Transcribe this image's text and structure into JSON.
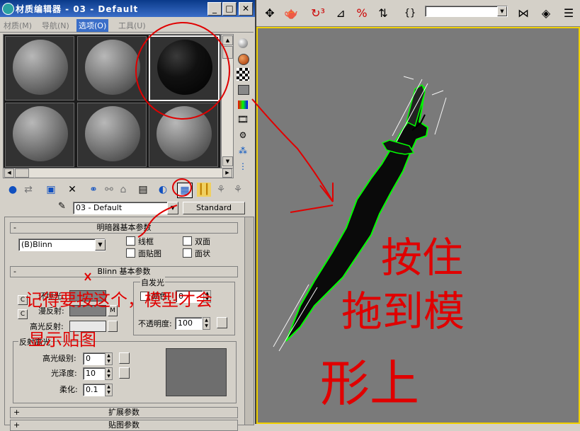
{
  "window": {
    "title": "材质编辑器 - 03 - Default",
    "minimize_icon": "minimize-icon",
    "maximize_icon": "maximize-icon",
    "close_icon": "close-icon"
  },
  "menu": [
    "材质(M)",
    "导航(N)",
    "选项(O)",
    "工具(U)"
  ],
  "material": {
    "name": "03 - Default",
    "type_button": "Standard"
  },
  "shader_basic": {
    "header": "明暗器基本参数",
    "shader": "(B)Blinn",
    "wire": "线框",
    "two_sided": "双面",
    "face_map": "面贴图",
    "faceted": "面状"
  },
  "blinn_basic": {
    "header": "Blinn 基本参数",
    "self_illum_group": "自发光",
    "ambient": "环境光:",
    "diffuse": "漫反射:",
    "specular": "高光反射:",
    "color_label": "颜色",
    "color_value": "0",
    "opacity_label": "不透明度:",
    "opacity_value": "100",
    "specular_group": "反射高光",
    "spec_level_label": "高光级别:",
    "spec_level_value": "0",
    "glossiness_label": "光泽度:",
    "glossiness_value": "10",
    "soften_label": "柔化:",
    "soften_value": "0.1"
  },
  "rollouts": {
    "extended": "扩展参数",
    "maps": "贴图参数"
  },
  "annotations": {
    "note_left_1": "记得要按这个，模型才会",
    "note_left_2": "显示贴图",
    "note_right_1": "按住",
    "note_right_2": "拖到模",
    "note_right_3": "形上"
  },
  "colors": {
    "title_bar": "#0a3a8a",
    "viewport_bg": "#7a7a7a",
    "annotation": "#e00000",
    "model_edge": "#00ff00"
  }
}
